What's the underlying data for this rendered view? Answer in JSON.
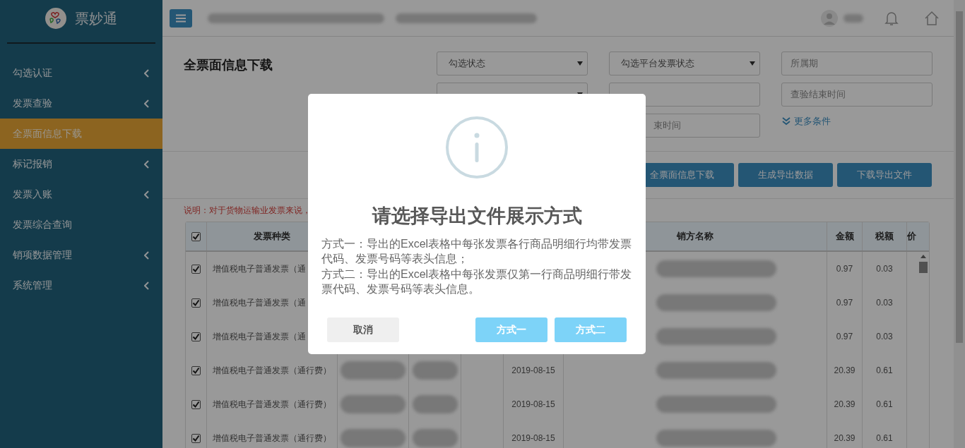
{
  "sidebar": {
    "logo_text": "票妙通",
    "items": [
      {
        "label": "勾选认证",
        "has_submenu": true,
        "selected": false
      },
      {
        "label": "发票查验",
        "has_submenu": true,
        "selected": false
      },
      {
        "label": "全票面信息下载",
        "has_submenu": false,
        "selected": true
      },
      {
        "label": "标记报销",
        "has_submenu": true,
        "selected": false
      },
      {
        "label": "发票入账",
        "has_submenu": true,
        "selected": false
      },
      {
        "label": "发票综合查询",
        "has_submenu": false,
        "selected": false
      },
      {
        "label": "销项数据管理",
        "has_submenu": true,
        "selected": false
      },
      {
        "label": "系统管理",
        "has_submenu": true,
        "selected": false
      }
    ]
  },
  "page_title": "全票面信息下载",
  "filters": [
    {
      "kind": "select",
      "placeholder": "勾选状态"
    },
    {
      "kind": "select",
      "placeholder": "勾选平台发票状态"
    },
    {
      "kind": "input",
      "placeholder": "所属期"
    },
    {
      "kind": "select"
    },
    {
      "kind": "input"
    },
    {
      "kind": "input",
      "placeholder": "查验结束时间"
    },
    {
      "kind": "empty"
    },
    {
      "kind": "partial-input",
      "placeholder": "束时间"
    },
    {
      "kind": "link",
      "label": "更多条件"
    }
  ],
  "actions": [
    "全票面信息下载",
    "生成导出数据",
    "下载导出文件"
  ],
  "note": "说明：对于货物运输业发票来说，",
  "table": {
    "header_checked": true,
    "columns": [
      "发票种类",
      "销方名称",
      "金额",
      "税额",
      "价"
    ],
    "rows": [
      {
        "checked": true,
        "type": "增值税电子普通发票（通",
        "amount": "0.97",
        "tax": "0.03"
      },
      {
        "checked": true,
        "type": "增值税电子普通发票（通",
        "amount": "0.97",
        "tax": "0.03"
      },
      {
        "checked": true,
        "type": "增值税电子普通发票（通",
        "amount": "0.97",
        "tax": "0.03"
      },
      {
        "checked": true,
        "type": "增值税电子普通发票（通行费）",
        "date": "2019-08-15",
        "amount": "20.39",
        "tax": "0.61"
      },
      {
        "checked": true,
        "type": "增值税电子普通发票（通行费）",
        "date": "2019-08-15",
        "amount": "20.39",
        "tax": "0.61"
      },
      {
        "checked": true,
        "type": "增值税电子普通发票（通行费）",
        "date": "2019-08-15",
        "amount": "20.39",
        "tax": "0.61"
      }
    ]
  },
  "dialog": {
    "title": "请选择导出文件展示方式",
    "lines": [
      "方式一：导出的Excel表格中每张发票各行商品明细行均带发票代码、发票号码等表头信息；",
      "方式二：导出的Excel表格中每张发票仅第一行商品明细行带发票代码、发票号码等表头信息。"
    ],
    "buttons": [
      {
        "label": "取消",
        "kind": "secondary"
      },
      {
        "label": "方式一",
        "kind": "primary"
      },
      {
        "label": "方式二",
        "kind": "primary"
      }
    ]
  }
}
